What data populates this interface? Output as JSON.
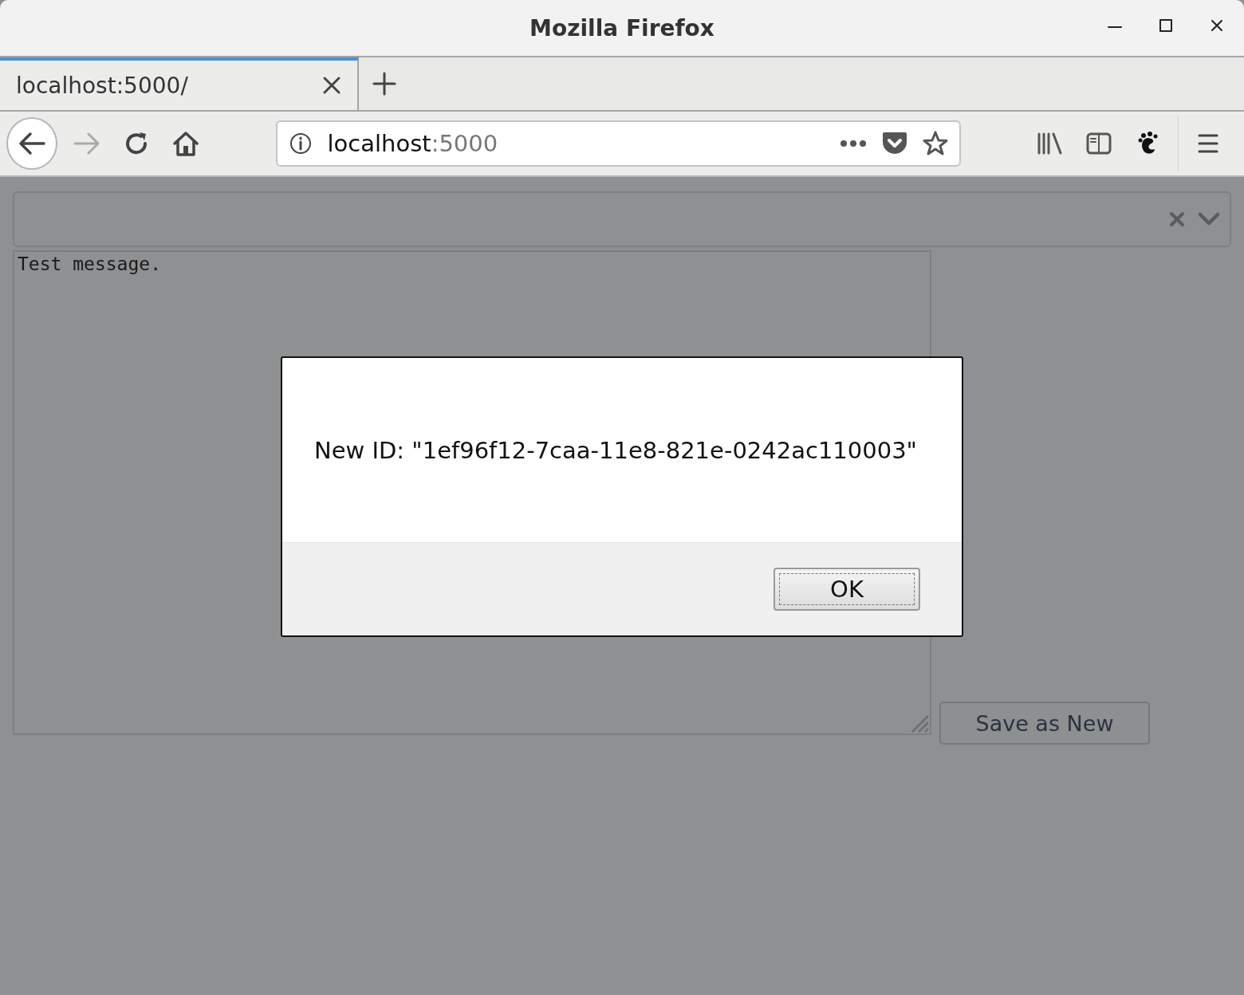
{
  "window": {
    "title": "Mozilla Firefox"
  },
  "tabs": [
    {
      "label": "localhost:5000/",
      "selected": true
    }
  ],
  "address": {
    "host": "localhost",
    "port": ":5000"
  },
  "page": {
    "message": "Test message.",
    "save_button": "Save as New"
  },
  "dialog": {
    "message": "New ID: \"1ef96f12-7caa-11e8-821e-0242ac110003\"",
    "button": "OK"
  }
}
